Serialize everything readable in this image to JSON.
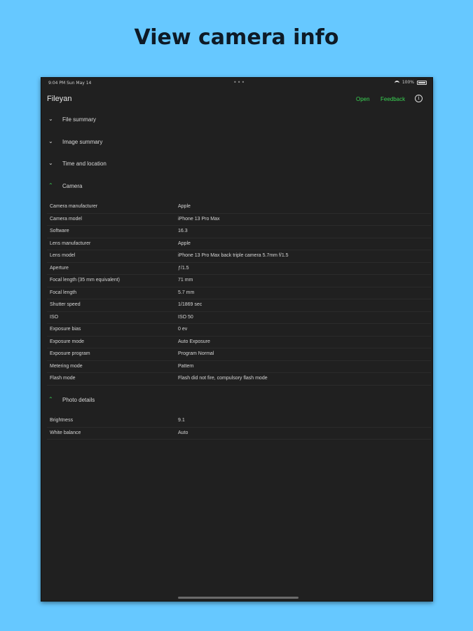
{
  "headline": "View camera info",
  "statusbar": {
    "time": "9:04 PM  Sun May 14",
    "dots": "•••",
    "battery_text": "100%"
  },
  "navbar": {
    "title": "Fileyan",
    "open_label": "Open",
    "feedback_label": "Feedback",
    "info_glyph": "i"
  },
  "sections": {
    "file_summary": "File summary",
    "image_summary": "Image summary",
    "time_location": "Time and location",
    "camera": "Camera",
    "photo_details": "Photo details"
  },
  "camera_rows": [
    {
      "key": "Camera manufacturer",
      "value": "Apple"
    },
    {
      "key": "Camera model",
      "value": "iPhone 13 Pro Max"
    },
    {
      "key": "Software",
      "value": "16.3"
    },
    {
      "key": "Lens manufacturer",
      "value": "Apple"
    },
    {
      "key": "Lens model",
      "value": "iPhone 13 Pro Max back triple camera 5.7mm f/1.5"
    },
    {
      "key": "Aperture",
      "value": "ƒ/1.5"
    },
    {
      "key": "Focal length (35 mm equivalent)",
      "value": "71 mm"
    },
    {
      "key": "Focal length",
      "value": "5.7 mm"
    },
    {
      "key": "Shutter speed",
      "value": "1/1869 sec"
    },
    {
      "key": "ISO",
      "value": "ISO 50"
    },
    {
      "key": "Exposure bias",
      "value": "0 ev"
    },
    {
      "key": "Exposure mode",
      "value": "Auto Exposure"
    },
    {
      "key": "Exposure program",
      "value": "Program Normal"
    },
    {
      "key": "Metering mode",
      "value": "Pattern"
    },
    {
      "key": "Flash mode",
      "value": "Flash did not fire, compulsory flash mode"
    }
  ],
  "photo_rows": [
    {
      "key": "Brightness",
      "value": "9.1"
    },
    {
      "key": "White balance",
      "value": "Auto"
    }
  ],
  "colors": {
    "background": "#66c8ff",
    "device": "#202020",
    "accent": "#39d353"
  }
}
